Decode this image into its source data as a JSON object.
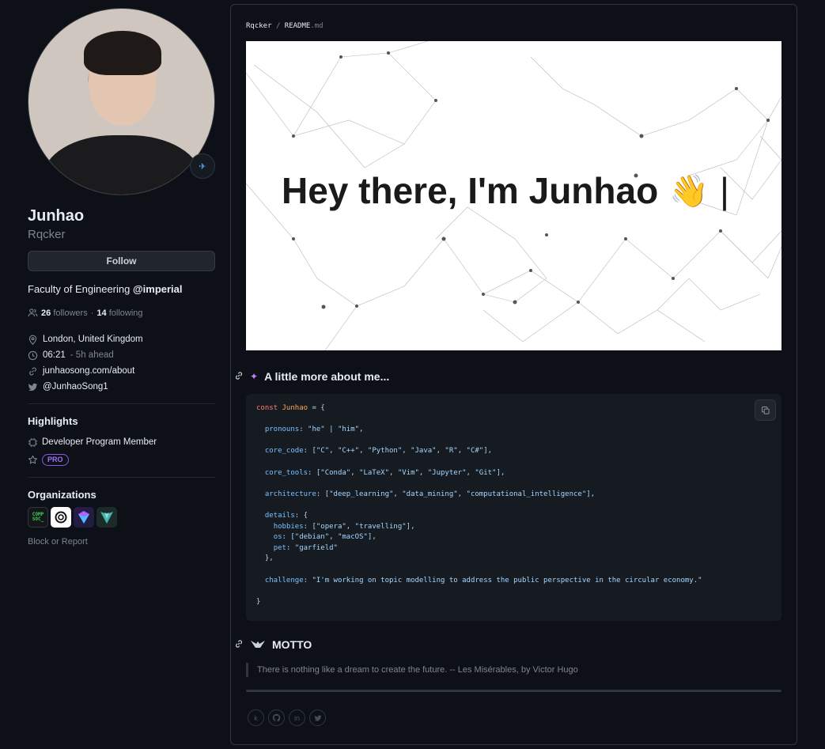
{
  "profile": {
    "name": "Junhao",
    "login": "Rqcker",
    "follow_label": "Follow",
    "bio_prefix": "Faculty of Engineering ",
    "bio_org": "@imperial",
    "followers_count": "26",
    "followers_label": "followers",
    "separator": "·",
    "following_count": "14",
    "following_label": "following",
    "location": "London, United Kingdom",
    "local_time": "06:21",
    "time_offset": "- 5h ahead",
    "website": "junhaosong.com/about",
    "twitter": "@JunhaoSong1"
  },
  "highlights": {
    "title": "Highlights",
    "program": "Developer Program Member",
    "pro_badge": "PRO"
  },
  "organizations": {
    "title": "Organizations",
    "compsoc_label": "COMP SOC_",
    "block_report": "Block or Report"
  },
  "readme": {
    "repo": "Rqcker",
    "sep": "/",
    "file": "README",
    "ext": ".md",
    "banner_text": "Hey there, I'm Junhao",
    "banner_cursor": "|",
    "about_heading": "A little more about me...",
    "motto_heading": "MOTTO",
    "motto_quote": "There is nothing like a dream to create the future. -- Les Misérables, by Victor Hugo"
  },
  "code": {
    "line1_kw": "const",
    "line1_var": "Junhao",
    "line1_rest": " = {",
    "pronouns_key": "pronouns",
    "pronouns_val": ": \"he\" | \"him\",",
    "core_code_key": "core_code",
    "core_code_val": ": [\"C\", \"C++\", \"Python\", \"Java\", \"R\", \"C#\"],",
    "core_tools_key": "core_tools",
    "core_tools_val": ": [\"Conda\", \"LaTeX\", \"Vim\", \"Jupyter\", \"Git\"],",
    "architecture_key": "architecture",
    "architecture_val": ": [\"deep_learning\", \"data_mining\", \"computational_intelligence\"],",
    "details_key": "details",
    "details_val": ": {",
    "hobbies_key": "hobbies",
    "hobbies_val": ": [\"opera\", \"travelling\"],",
    "os_key": "os",
    "os_val": ": [\"debian\", \"macOS\"],",
    "pet_key": "pet",
    "pet_val": ": \"garfield\"",
    "details_close": "},",
    "challenge_key": "challenge",
    "challenge_val": ": \"I'm working on topic modelling to address the public perspective in the circular economy.\"",
    "close": "}"
  },
  "colors": {
    "background": "#0d1117",
    "pro_accent": "#a371f7",
    "link_accent": "#58a6ff"
  }
}
